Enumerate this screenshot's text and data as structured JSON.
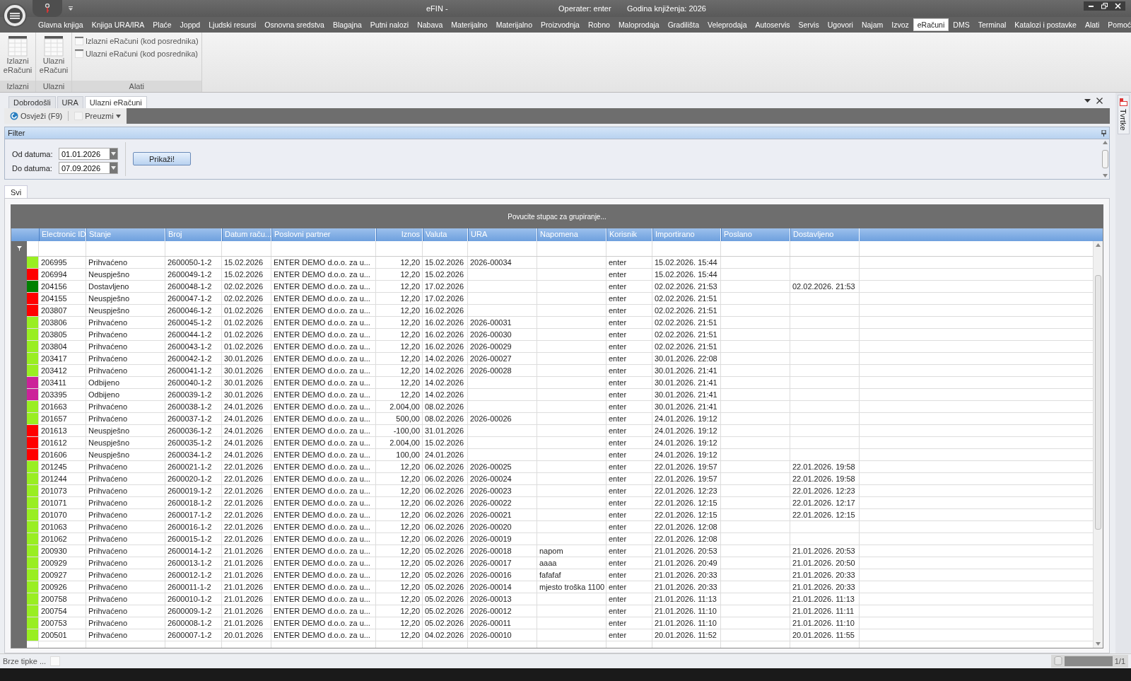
{
  "window": {
    "title": "eFIN -",
    "operator": "Operater: enter",
    "year": "Godina knjiženja: 2026"
  },
  "menu": [
    {
      "label": "Glavna knjiga",
      "selected": false
    },
    {
      "label": "Knjiga URA/IRA",
      "selected": false
    },
    {
      "label": "Plaće",
      "selected": false
    },
    {
      "label": "Joppd",
      "selected": false
    },
    {
      "label": "Ljudski resursi",
      "selected": false
    },
    {
      "label": "Osnovna sredstva",
      "selected": false
    },
    {
      "label": "Blagajna",
      "selected": false
    },
    {
      "label": "Putni nalozi",
      "selected": false
    },
    {
      "label": "Nabava",
      "selected": false
    },
    {
      "label": "Materijalno",
      "selected": false
    },
    {
      "label": "Materijalno",
      "selected": false
    },
    {
      "label": "Proizvodnja",
      "selected": false
    },
    {
      "label": "Robno",
      "selected": false
    },
    {
      "label": "Maloprodaja",
      "selected": false
    },
    {
      "label": "Gradilišta",
      "selected": false
    },
    {
      "label": "Veleprodaja",
      "selected": false
    },
    {
      "label": "Autoservis",
      "selected": false
    },
    {
      "label": "Servis",
      "selected": false
    },
    {
      "label": "Ugovori",
      "selected": false
    },
    {
      "label": "Najam",
      "selected": false
    },
    {
      "label": "Izvoz",
      "selected": false
    },
    {
      "label": "eRačuni",
      "selected": true
    },
    {
      "label": "DMS",
      "selected": false
    },
    {
      "label": "Terminal",
      "selected": false
    },
    {
      "label": "Katalozi i postavke",
      "selected": false
    },
    {
      "label": "Alati",
      "selected": false
    },
    {
      "label": "Pomoć",
      "selected": false
    }
  ],
  "ribbon": [
    {
      "label": "Izlazni",
      "kind": "large",
      "buttons": [
        "Izlazni eRačuni"
      ]
    },
    {
      "label": "Ulazni",
      "kind": "large",
      "buttons": [
        "Ulazni eRačuni"
      ]
    },
    {
      "label": "Alati",
      "kind": "small",
      "buttons": [
        "Izlazni eRačuni (kod posrednika)",
        "Ulazni eRačuni (kod posrednika)"
      ]
    }
  ],
  "document_tabs": [
    {
      "label": "Dobrodošli",
      "selected": false
    },
    {
      "label": "URA",
      "selected": false
    },
    {
      "label": "Ulazni eRačuni",
      "selected": true
    }
  ],
  "toolbar": [
    {
      "label": "Osvježi (F9)",
      "kind": "refresh"
    },
    {
      "label": "Preuzmi",
      "kind": "dropdown"
    }
  ],
  "filter": {
    "title": "Filter",
    "fields": [
      {
        "label": "Od datuma:",
        "value": "01.01.2026"
      },
      {
        "label": "Do datuma:",
        "value": "07.09.2026"
      }
    ],
    "button": "Prikaži!"
  },
  "side_panel": {
    "label": "Tvrtke"
  },
  "grid": {
    "tabs": [
      {
        "label": "Svi",
        "selected": true
      }
    ],
    "group_hint": "Povucite stupac za grupiranje...",
    "columns": [
      "Electronic ID",
      "Stanje",
      "Broj",
      "Datum raču...",
      "Poslovni partner",
      "Iznos",
      "Valuta",
      "URA",
      "Napomena",
      "Korisnik",
      "Importirano",
      "Poslano",
      "Dostavljeno"
    ],
    "rows": [
      {
        "color": "#99ee22",
        "cells": [
          "206995",
          "Prihvaćeno",
          "2600050-1-2",
          "15.02.2026",
          "ENTER DEMO d.o.o. za u...",
          "12,20",
          "15.02.2026",
          "2026-00034",
          null,
          "enter",
          "15.02.2026. 15:44",
          null,
          null
        ]
      },
      {
        "color": "#ff0000",
        "cells": [
          "206994",
          "Neuspješno",
          "2600049-1-2",
          "15.02.2026",
          "ENTER DEMO d.o.o. za u...",
          "12,20",
          "15.02.2026",
          null,
          null,
          "enter",
          "15.02.2026. 15:44",
          null,
          null
        ]
      },
      {
        "color": "#008000",
        "cells": [
          "204156",
          "Dostavljeno",
          "2600048-1-2",
          "02.02.2026",
          "ENTER DEMO d.o.o. za u...",
          "12,20",
          "17.02.2026",
          null,
          null,
          "enter",
          "02.02.2026. 21:53",
          null,
          "02.02.2026. 21:53"
        ]
      },
      {
        "color": "#ff0000",
        "cells": [
          "204155",
          "Neuspješno",
          "2600047-1-2",
          "02.02.2026",
          "ENTER DEMO d.o.o. za u...",
          "12,20",
          "17.02.2026",
          null,
          null,
          "enter",
          "02.02.2026. 21:51",
          null,
          null
        ]
      },
      {
        "color": "#ff0000",
        "cells": [
          "203807",
          "Neuspješno",
          "2600046-1-2",
          "01.02.2026",
          "ENTER DEMO d.o.o. za u...",
          "12,20",
          "16.02.2026",
          null,
          null,
          "enter",
          "02.02.2026. 21:51",
          null,
          null
        ]
      },
      {
        "color": "#99ee22",
        "cells": [
          "203806",
          "Prihvaćeno",
          "2600045-1-2",
          "01.02.2026",
          "ENTER DEMO d.o.o. za u...",
          "12,20",
          "16.02.2026",
          "2026-00031",
          null,
          "enter",
          "02.02.2026. 21:51",
          null,
          null
        ]
      },
      {
        "color": "#99ee22",
        "cells": [
          "203805",
          "Prihvaćeno",
          "2600044-1-2",
          "01.02.2026",
          "ENTER DEMO d.o.o. za u...",
          "12,20",
          "16.02.2026",
          "2026-00030",
          null,
          "enter",
          "02.02.2026. 21:51",
          null,
          null
        ]
      },
      {
        "color": "#99ee22",
        "cells": [
          "203804",
          "Prihvaćeno",
          "2600043-1-2",
          "01.02.2026",
          "ENTER DEMO d.o.o. za u...",
          "12,20",
          "16.02.2026",
          "2026-00029",
          null,
          "enter",
          "02.02.2026. 21:51",
          null,
          null
        ]
      },
      {
        "color": "#99ee22",
        "cells": [
          "203417",
          "Prihvaćeno",
          "2600042-1-2",
          "30.01.2026",
          "ENTER DEMO d.o.o. za u...",
          "12,20",
          "14.02.2026",
          "2026-00027",
          null,
          "enter",
          "30.01.2026. 22:08",
          null,
          null
        ]
      },
      {
        "color": "#99ee22",
        "cells": [
          "203412",
          "Prihvaćeno",
          "2600041-1-2",
          "30.01.2026",
          "ENTER DEMO d.o.o. za u...",
          "12,20",
          "14.02.2026",
          "2026-00028",
          null,
          "enter",
          "30.01.2026. 21:41",
          null,
          null
        ]
      },
      {
        "color": "#cc2299",
        "cells": [
          "203411",
          "Odbijeno",
          "2600040-1-2",
          "30.01.2026",
          "ENTER DEMO d.o.o. za u...",
          "12,20",
          "14.02.2026",
          null,
          null,
          "enter",
          "30.01.2026. 21:41",
          null,
          null
        ]
      },
      {
        "color": "#cc2299",
        "cells": [
          "203395",
          "Odbijeno",
          "2600039-1-2",
          "30.01.2026",
          "ENTER DEMO d.o.o. za u...",
          "12,20",
          "14.02.2026",
          null,
          null,
          "enter",
          "30.01.2026. 21:41",
          null,
          null
        ]
      },
      {
        "color": "#99ee22",
        "cells": [
          "201663",
          "Prihvaćeno",
          "2600038-1-2",
          "24.01.2026",
          "ENTER DEMO d.o.o. za u...",
          "2.004,00",
          "08.02.2026",
          null,
          null,
          "enter",
          "30.01.2026. 21:41",
          null,
          null
        ]
      },
      {
        "color": "#99ee22",
        "cells": [
          "201657",
          "Prihvaćeno",
          "2600037-1-2",
          "24.01.2026",
          "ENTER DEMO d.o.o. za u...",
          "500,00",
          "08.02.2026",
          "2026-00026",
          null,
          "enter",
          "24.01.2026. 19:12",
          null,
          null
        ]
      },
      {
        "color": "#ff0000",
        "cells": [
          "201613",
          "Neuspješno",
          "2600036-1-2",
          "24.01.2026",
          "ENTER DEMO d.o.o. za u...",
          "-100,00",
          "31.01.2026",
          null,
          null,
          "enter",
          "24.01.2026. 19:12",
          null,
          null
        ]
      },
      {
        "color": "#ff0000",
        "cells": [
          "201612",
          "Neuspješno",
          "2600035-1-2",
          "24.01.2026",
          "ENTER DEMO d.o.o. za u...",
          "2.004,00",
          "15.02.2026",
          null,
          null,
          "enter",
          "24.01.2026. 19:12",
          null,
          null
        ]
      },
      {
        "color": "#ff0000",
        "cells": [
          "201606",
          "Neuspješno",
          "2600034-1-2",
          "24.01.2026",
          "ENTER DEMO d.o.o. za u...",
          "100,00",
          "24.01.2026",
          null,
          null,
          "enter",
          "24.01.2026. 19:12",
          null,
          null
        ]
      },
      {
        "color": "#99ee22",
        "cells": [
          "201245",
          "Prihvaćeno",
          "2600021-1-2",
          "22.01.2026",
          "ENTER DEMO d.o.o. za u...",
          "12,20",
          "06.02.2026",
          "2026-00025",
          null,
          "enter",
          "22.01.2026. 19:57",
          null,
          "22.01.2026. 19:58"
        ]
      },
      {
        "color": "#99ee22",
        "cells": [
          "201244",
          "Prihvaćeno",
          "2600020-1-2",
          "22.01.2026",
          "ENTER DEMO d.o.o. za u...",
          "12,20",
          "06.02.2026",
          "2026-00024",
          null,
          "enter",
          "22.01.2026. 19:57",
          null,
          "22.01.2026. 19:58"
        ]
      },
      {
        "color": "#99ee22",
        "cells": [
          "201073",
          "Prihvaćeno",
          "2600019-1-2",
          "22.01.2026",
          "ENTER DEMO d.o.o. za u...",
          "12,20",
          "06.02.2026",
          "2026-00023",
          null,
          "enter",
          "22.01.2026. 12:23",
          null,
          "22.01.2026. 12:23"
        ]
      },
      {
        "color": "#99ee22",
        "cells": [
          "201071",
          "Prihvaćeno",
          "2600018-1-2",
          "22.01.2026",
          "ENTER DEMO d.o.o. za u...",
          "12,20",
          "06.02.2026",
          "2026-00022",
          null,
          "enter",
          "22.01.2026. 12:15",
          null,
          "22.01.2026. 12:17"
        ]
      },
      {
        "color": "#99ee22",
        "cells": [
          "201070",
          "Prihvaćeno",
          "2600017-1-2",
          "22.01.2026",
          "ENTER DEMO d.o.o. za u...",
          "12,20",
          "06.02.2026",
          "2026-00021",
          null,
          "enter",
          "22.01.2026. 12:15",
          null,
          "22.01.2026. 12:15"
        ]
      },
      {
        "color": "#99ee22",
        "cells": [
          "201063",
          "Prihvaćeno",
          "2600016-1-2",
          "22.01.2026",
          "ENTER DEMO d.o.o. za u...",
          "12,20",
          "06.02.2026",
          "2026-00020",
          null,
          "enter",
          "22.01.2026. 12:08",
          null,
          null
        ]
      },
      {
        "color": "#99ee22",
        "cells": [
          "201062",
          "Prihvaćeno",
          "2600015-1-2",
          "22.01.2026",
          "ENTER DEMO d.o.o. za u...",
          "12,20",
          "06.02.2026",
          "2026-00019",
          null,
          "enter",
          "22.01.2026. 12:08",
          null,
          null
        ]
      },
      {
        "color": "#99ee22",
        "cells": [
          "200930",
          "Prihvaćeno",
          "2600014-1-2",
          "21.01.2026",
          "ENTER DEMO d.o.o. za u...",
          "12,20",
          "05.02.2026",
          "2026-00018",
          "napom",
          "enter",
          "21.01.2026. 20:53",
          null,
          "21.01.2026. 20:53"
        ]
      },
      {
        "color": "#99ee22",
        "cells": [
          "200929",
          "Prihvaćeno",
          "2600013-1-2",
          "21.01.2026",
          "ENTER DEMO d.o.o. za u...",
          "12,20",
          "05.02.2026",
          "2026-00017",
          "aaaa",
          "enter",
          "21.01.2026. 20:49",
          null,
          "21.01.2026. 20:50"
        ]
      },
      {
        "color": "#99ee22",
        "cells": [
          "200927",
          "Prihvaćeno",
          "2600012-1-2",
          "21.01.2026",
          "ENTER DEMO d.o.o. za u...",
          "12,20",
          "05.02.2026",
          "2026-00016",
          "fafafaf",
          "enter",
          "21.01.2026. 20:33",
          null,
          "21.01.2026. 20:33"
        ]
      },
      {
        "color": "#99ee22",
        "cells": [
          "200926",
          "Prihvaćeno",
          "2600011-1-2",
          "21.01.2026",
          "ENTER DEMO d.o.o. za u...",
          "12,20",
          "05.02.2026",
          "2026-00014",
          "mjesto troška 1100",
          "enter",
          "21.01.2026. 20:33",
          null,
          "21.01.2026. 20:33"
        ]
      },
      {
        "color": "#99ee22",
        "cells": [
          "200758",
          "Prihvaćeno",
          "2600010-1-2",
          "21.01.2026",
          "ENTER DEMO d.o.o. za u...",
          "12,20",
          "05.02.2026",
          "2026-00013",
          null,
          "enter",
          "21.01.2026. 11:13",
          null,
          "21.01.2026. 11:13"
        ]
      },
      {
        "color": "#99ee22",
        "cells": [
          "200754",
          "Prihvaćeno",
          "2600009-1-2",
          "21.01.2026",
          "ENTER DEMO d.o.o. za u...",
          "12,20",
          "05.02.2026",
          "2026-00012",
          null,
          "enter",
          "21.01.2026. 11:10",
          null,
          "21.01.2026. 11:11"
        ]
      },
      {
        "color": "#99ee22",
        "cells": [
          "200753",
          "Prihvaćeno",
          "2600008-1-2",
          "21.01.2026",
          "ENTER DEMO d.o.o. za u...",
          "12,20",
          "05.02.2026",
          "2026-00011",
          null,
          "enter",
          "21.01.2026. 11:10",
          null,
          "21.01.2026. 11:10"
        ]
      },
      {
        "color": "#99ee22",
        "cells": [
          "200501",
          "Prihvaćeno",
          "2600007-1-2",
          "20.01.2026",
          "ENTER DEMO d.o.o. za u...",
          "12,20",
          "04.02.2026",
          "2026-00010",
          null,
          "enter",
          "20.01.2026. 11:52",
          null,
          "20.01.2026. 11:55"
        ]
      }
    ]
  },
  "status_bar": {
    "hint": "Brze tipke ...",
    "page": "1/1"
  }
}
